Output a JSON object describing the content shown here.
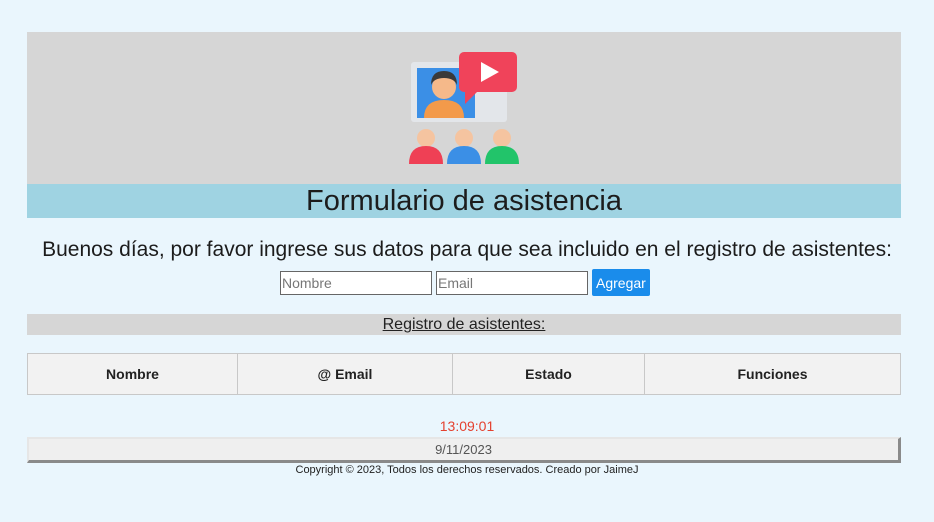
{
  "header": {
    "logo_icon": "video-conference-icon",
    "title": "Formulario de asistencia"
  },
  "greeting": "Buenos días, por favor ingrese sus datos para que sea incluido en el registro de asistentes:",
  "form": {
    "name_placeholder": "Nombre",
    "email_placeholder": "Email",
    "submit_label": "Agregar",
    "submit_color": "#1a8ceb"
  },
  "registry": {
    "heading": "Registro de asistentes:",
    "columns": [
      "Nombre",
      "@ Email",
      "Estado",
      "Funciones"
    ]
  },
  "clock": {
    "time": "13:09:01",
    "time_color": "#e4412f",
    "date": "9/11/2023"
  },
  "footer": {
    "copyright": "Copyright © 2023, Todos los derechos reservados. Creado por JaimeJ"
  },
  "colors": {
    "page_background": "#eaf6fd",
    "hero_background": "#d6d6d6",
    "title_bar": "#9fd3e2"
  }
}
